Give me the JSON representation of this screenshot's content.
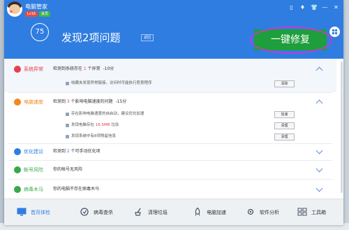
{
  "app": {
    "title": "电脑管家",
    "level_badge": "Lv16",
    "vip_badge": "会员"
  },
  "window_controls": [
    "▯",
    "♦",
    "👕",
    "—",
    "✕"
  ],
  "header": {
    "score": "75",
    "headline": "发现2项问题",
    "rescan_label": "返回",
    "fix_button_label": "一键修复"
  },
  "sections": [
    {
      "name": "系统异常",
      "prefix": "检测到系统存在 ",
      "count": "1",
      "suffix": " 个异常",
      "score": "-10分",
      "items": [
        {
          "text": "收藏夹发现异常链接，访问时可能执行恶意程序",
          "action": "清除"
        }
      ]
    },
    {
      "name": "电脑速度",
      "prefix": "检测到 ",
      "count": "3",
      "suffix": " 个影响电脑速度的问题",
      "score": "-15分",
      "items": [
        {
          "text": "存在影响电脑速度的自启动，建议优化加速",
          "action": "加速"
        },
        {
          "text_prefix": "发现电脑存在 ",
          "highlight": "16.5MB",
          "text_suffix": " 垃圾",
          "action": "清理"
        },
        {
          "text": "发现系统中有8项残留信息",
          "action": "清理"
        }
      ]
    },
    {
      "name": "优化建议",
      "prefix": "检测到 ",
      "count": "2",
      "suffix": " 个可手动优化项"
    },
    {
      "name": "帐号风险",
      "description": "你的帐号无风险"
    },
    {
      "name": "病毒木马",
      "description": "你的电脑不存在病毒木马"
    }
  ],
  "nav": [
    {
      "label": "首页体检",
      "icon": "monitor-icon"
    },
    {
      "label": "病毒查杀",
      "icon": "shield-icon"
    },
    {
      "label": "清理垃圾",
      "icon": "broom-icon"
    },
    {
      "label": "电脑加速",
      "icon": "rocket-icon"
    },
    {
      "label": "软件分析",
      "icon": "gear-icon"
    },
    {
      "label": "工具箱",
      "icon": "toolbox-icon"
    }
  ]
}
